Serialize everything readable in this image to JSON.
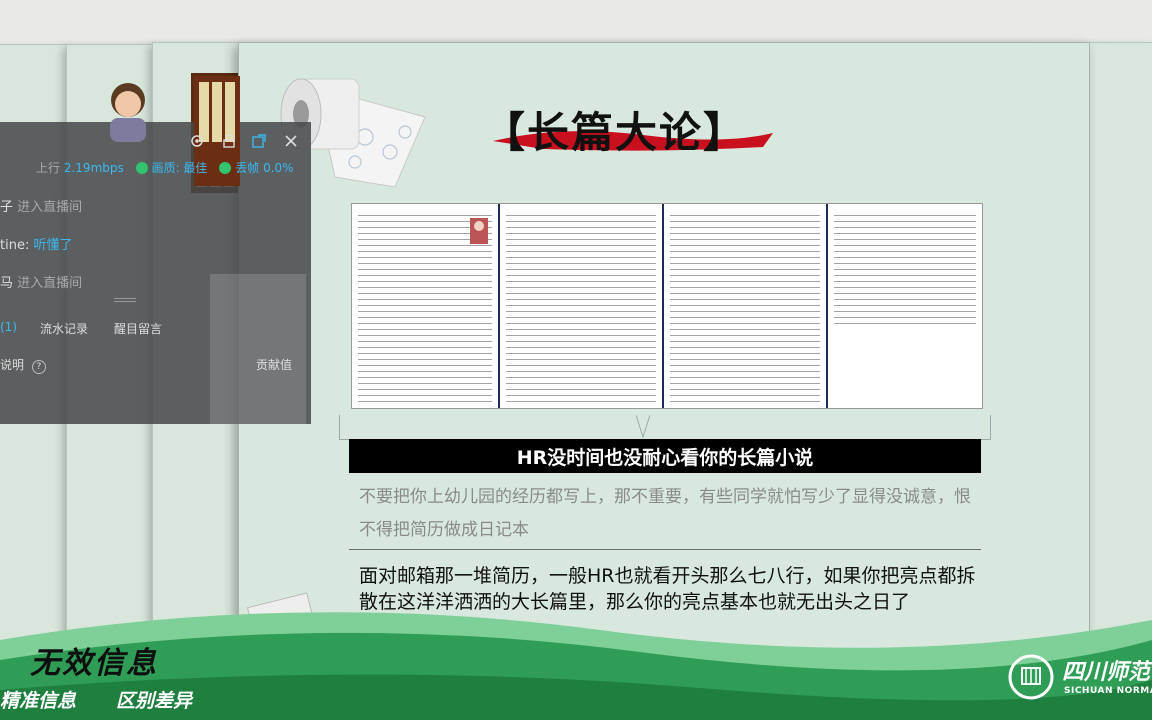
{
  "slide": {
    "title": "【长篇大论】",
    "highlight_bar": "HR没时间也没耐心看你的长篇小说",
    "gray_text": "不要把你上幼儿园的经历都写上，那不重要，有些同学就怕写少了显得没诚意，恨不得把简历做成日记本",
    "main_text": "面对邮箱那一堆简历，一般HR也就看开头那么七八行，如果你把亮点都拆散在这洋洋洒洒的大长篇里，那么你的亮点基本也就无出头之日了"
  },
  "overlay": {
    "upload_label": "上行",
    "upload_value": "2.19mbps",
    "quality_label": "画质: 最佳",
    "frame_loss_label": "丢帧 0.0%",
    "chat": [
      {
        "user": "子",
        "message": "进入直播间",
        "highlight": false
      },
      {
        "user": "tine:",
        "message": "听懂了",
        "highlight": true
      },
      {
        "user": "马",
        "message": "进入直播间",
        "highlight": false
      }
    ],
    "tabs": [
      "(1)",
      "流水记录",
      "醒目留言"
    ],
    "help_label": "说明",
    "contribution_label": "贡献值"
  },
  "banner": {
    "title": "无效信息",
    "sub_left": "精准信息",
    "sub_right": "区别差异",
    "school_name": "四川师范",
    "school_en": "SICHUAN NORMAL U"
  },
  "colors": {
    "slide_bg": "#d9e8df",
    "banner_green": "#2f9d55",
    "banner_light": "#7fcf98",
    "accent_blue": "#3bb8f0",
    "status_green": "#32c36c",
    "title_brush_red": "#c8101e"
  },
  "icons": {
    "settings": "gear-icon",
    "lock": "lock-icon",
    "popout": "popout-icon",
    "close": "close-icon",
    "help": "question-icon"
  }
}
